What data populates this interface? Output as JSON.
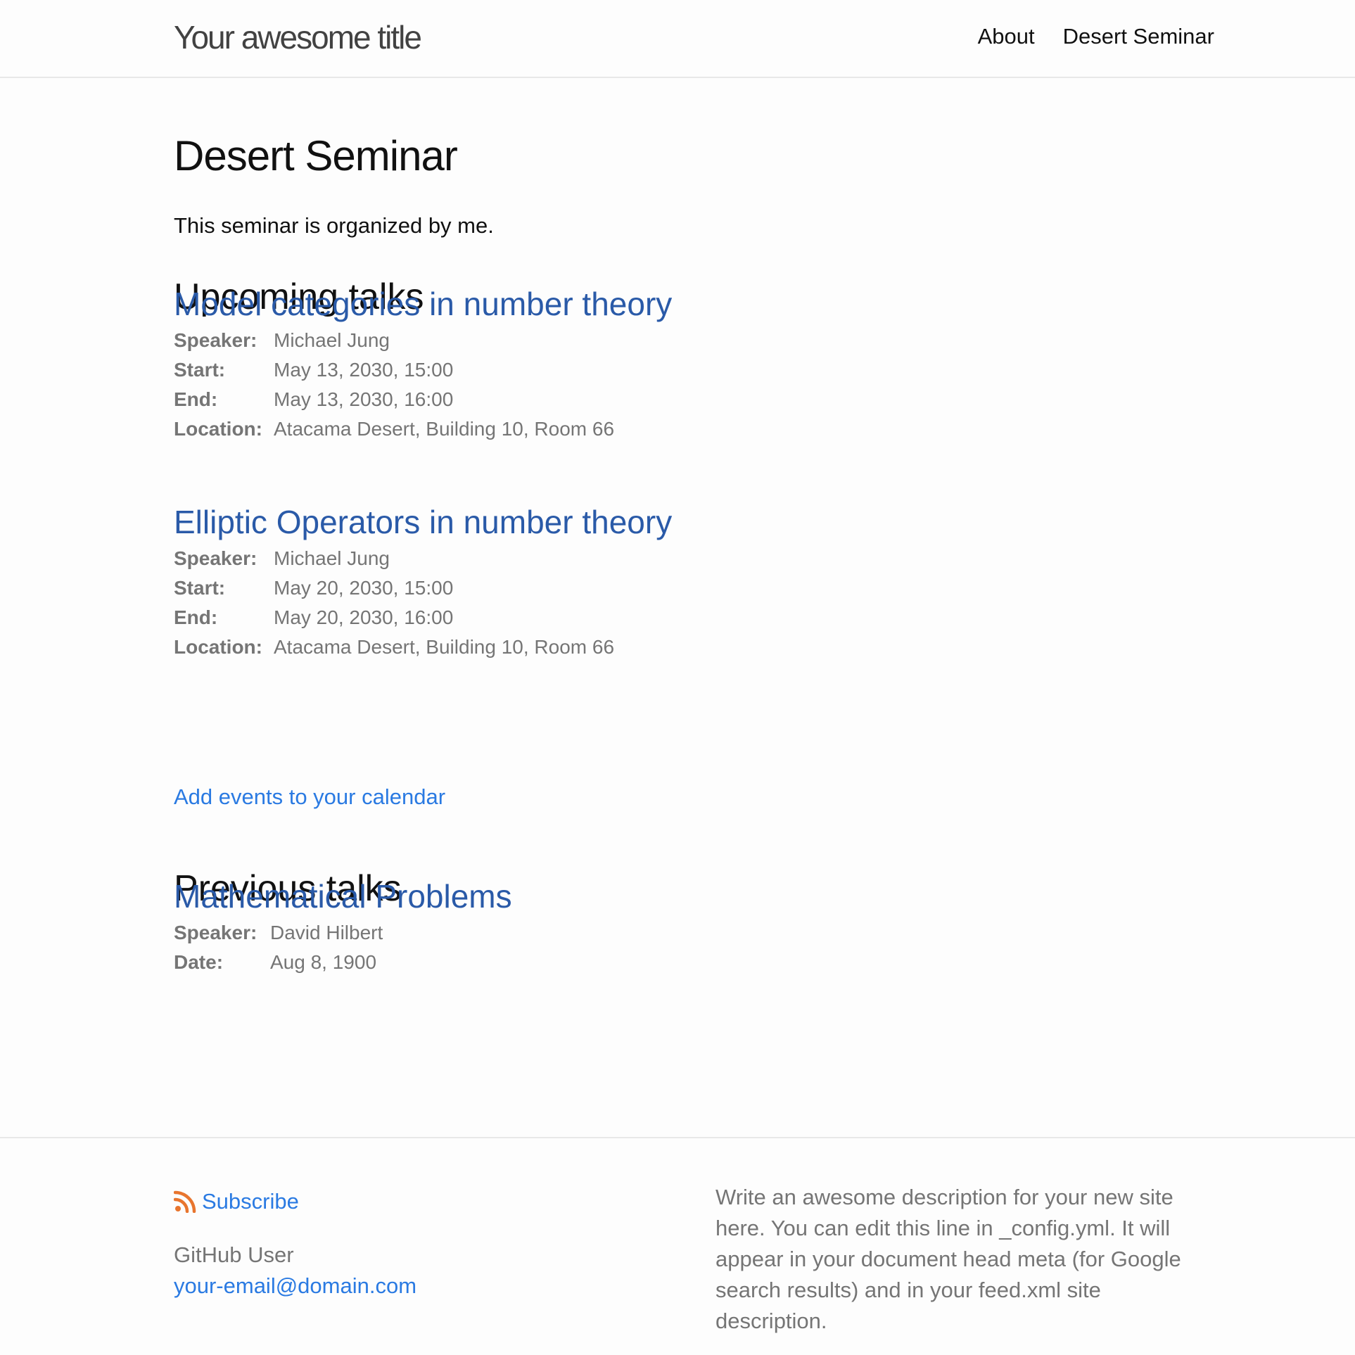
{
  "header": {
    "site_title": "Your awesome title",
    "nav": [
      "About",
      "Desert Seminar"
    ]
  },
  "main": {
    "page_title": "Desert Seminar",
    "intro": "This seminar is organized by me.",
    "upcoming_heading": "Upcoming talks",
    "upcoming_talks": [
      {
        "title": "Model categories in number theory",
        "fields": [
          {
            "key": "Speaker:",
            "value": "Michael Jung"
          },
          {
            "key": "Start:",
            "value": "May 13, 2030, 15:00"
          },
          {
            "key": "End:",
            "value": "May 13, 2030, 16:00"
          },
          {
            "key": "Location:",
            "value": "Atacama Desert, Building 10, Room 66"
          }
        ]
      },
      {
        "title": "Elliptic Operators in number theory",
        "fields": [
          {
            "key": "Speaker:",
            "value": "Michael Jung"
          },
          {
            "key": "Start:",
            "value": "May 20, 2030, 15:00"
          },
          {
            "key": "End:",
            "value": "May 20, 2030, 16:00"
          },
          {
            "key": "Location:",
            "value": "Atacama Desert, Building 10, Room 66"
          }
        ]
      }
    ],
    "calendar_link": "Add events to your calendar",
    "previous_heading": "Previous talks",
    "previous_talks": [
      {
        "title": "Mathematical Problems",
        "fields": [
          {
            "key": "Speaker:",
            "value": "David Hilbert"
          },
          {
            "key": "Date:",
            "value": "Aug 8, 1900"
          }
        ]
      }
    ]
  },
  "footer": {
    "subscribe": "Subscribe",
    "user": "GitHub User",
    "email": "your-email@domain.com",
    "description": "Write an awesome description for your new site here. You can edit this line in _config.yml. It will appear in your document head meta (for Google search results) and in your feed.xml site description."
  },
  "colors": {
    "link": "#2a7ae2",
    "talk_title": "#2a5aa8",
    "muted": "#757575",
    "rss": "#e8752e"
  }
}
